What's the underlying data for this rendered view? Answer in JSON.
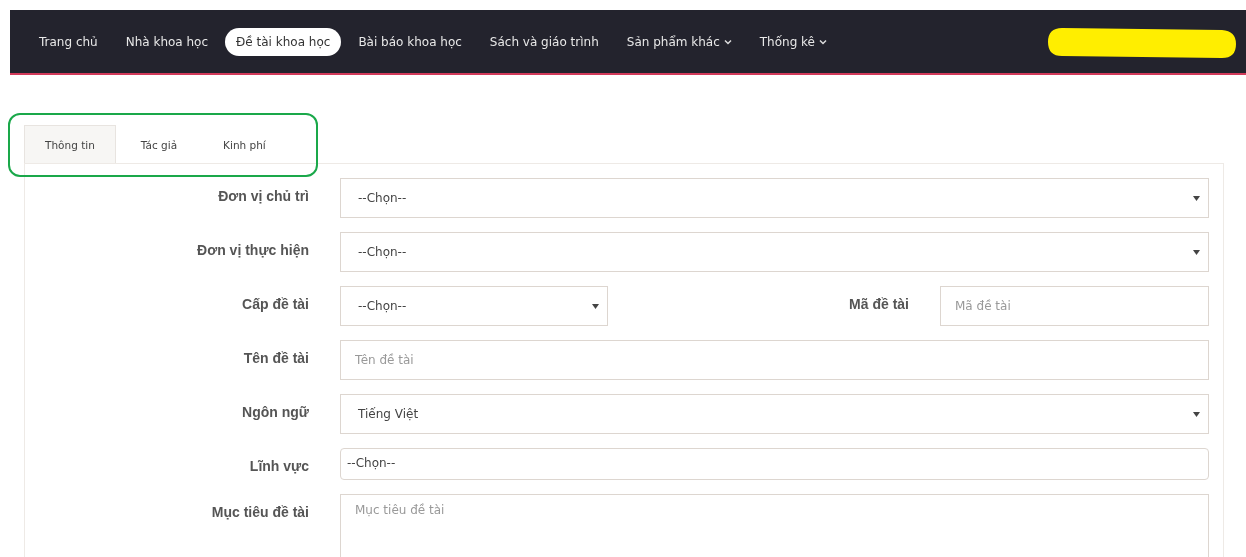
{
  "navbar": {
    "items": [
      {
        "label": "Trang chủ",
        "selected": false,
        "dropdown": false
      },
      {
        "label": "Nhà khoa học",
        "selected": false,
        "dropdown": false
      },
      {
        "label": "Đề tài khoa học",
        "selected": true,
        "dropdown": false
      },
      {
        "label": "Bài báo khoa học",
        "selected": false,
        "dropdown": false
      },
      {
        "label": "Sách và giáo trình",
        "selected": false,
        "dropdown": false
      },
      {
        "label": "Sản phẩm khác",
        "selected": false,
        "dropdown": true
      },
      {
        "label": "Thống kê",
        "selected": false,
        "dropdown": true
      }
    ],
    "redacted": true
  },
  "tabs": [
    {
      "label": "Thông tin",
      "selected": true
    },
    {
      "label": "Tác giả",
      "selected": false
    },
    {
      "label": "Kinh phí",
      "selected": false
    }
  ],
  "tabs_highlighted": true,
  "form": {
    "rows": [
      [
        {
          "label": "Đơn vị chủ trì",
          "kind": "select",
          "value": "--Chọn--"
        }
      ],
      [
        {
          "label": "Đơn vị thực hiện",
          "kind": "select",
          "value": "--Chọn--"
        }
      ],
      [
        {
          "label": "Cấp đề tài",
          "kind": "select",
          "value": "--Chọn--"
        },
        {
          "label": "Mã đề tài",
          "kind": "input",
          "placeholder": "Mã đề tài"
        }
      ],
      [
        {
          "label": "Tên đề tài",
          "kind": "input",
          "placeholder": "Tên đề tài"
        }
      ],
      [
        {
          "label": "Ngôn ngữ",
          "kind": "select",
          "value": "Tiếng Việt"
        }
      ],
      [
        {
          "label": "Lĩnh vực",
          "kind": "combo",
          "value": "--Chọn--"
        }
      ],
      [
        {
          "label": "Mục tiêu đề tài",
          "kind": "textarea",
          "placeholder": "Mục tiêu đề tài"
        }
      ]
    ]
  }
}
